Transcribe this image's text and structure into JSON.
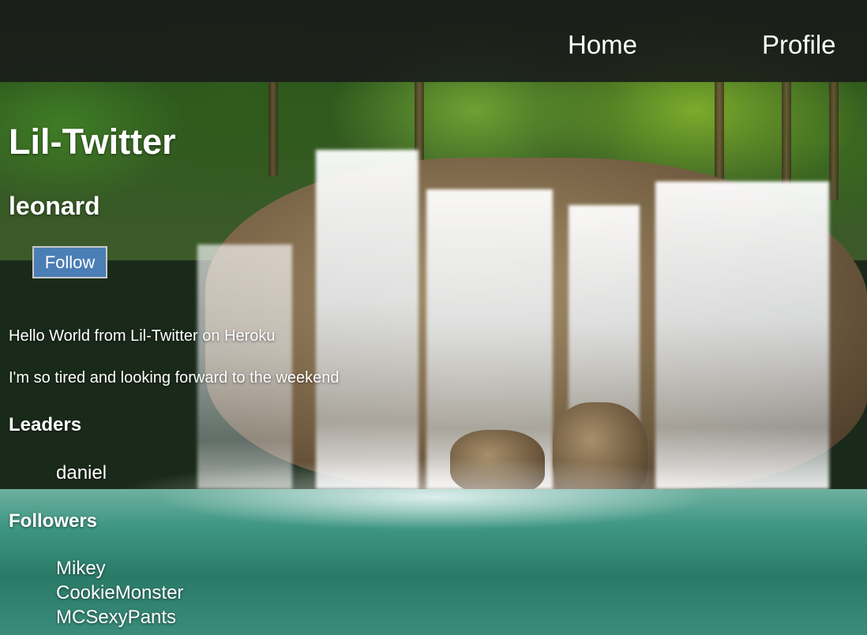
{
  "nav": {
    "home_label": "Home",
    "profile_label": "Profile"
  },
  "app": {
    "title": "Lil-Twitter"
  },
  "profile": {
    "username": "leonard",
    "follow_label": "Follow"
  },
  "tweets": [
    "Hello World from Lil-Twitter on Heroku",
    "I'm so tired and looking forward to the weekend"
  ],
  "leaders": {
    "heading": "Leaders",
    "users": [
      "daniel"
    ]
  },
  "followers": {
    "heading": "Followers",
    "users": [
      "Mikey",
      "CookieMonster",
      "MCSexyPants"
    ]
  },
  "colors": {
    "navbar_bg": "#191c19",
    "follow_button_bg": "#4a7eb5",
    "text": "#ffffff"
  },
  "background": {
    "icon": "waterfall-forest-photo"
  }
}
